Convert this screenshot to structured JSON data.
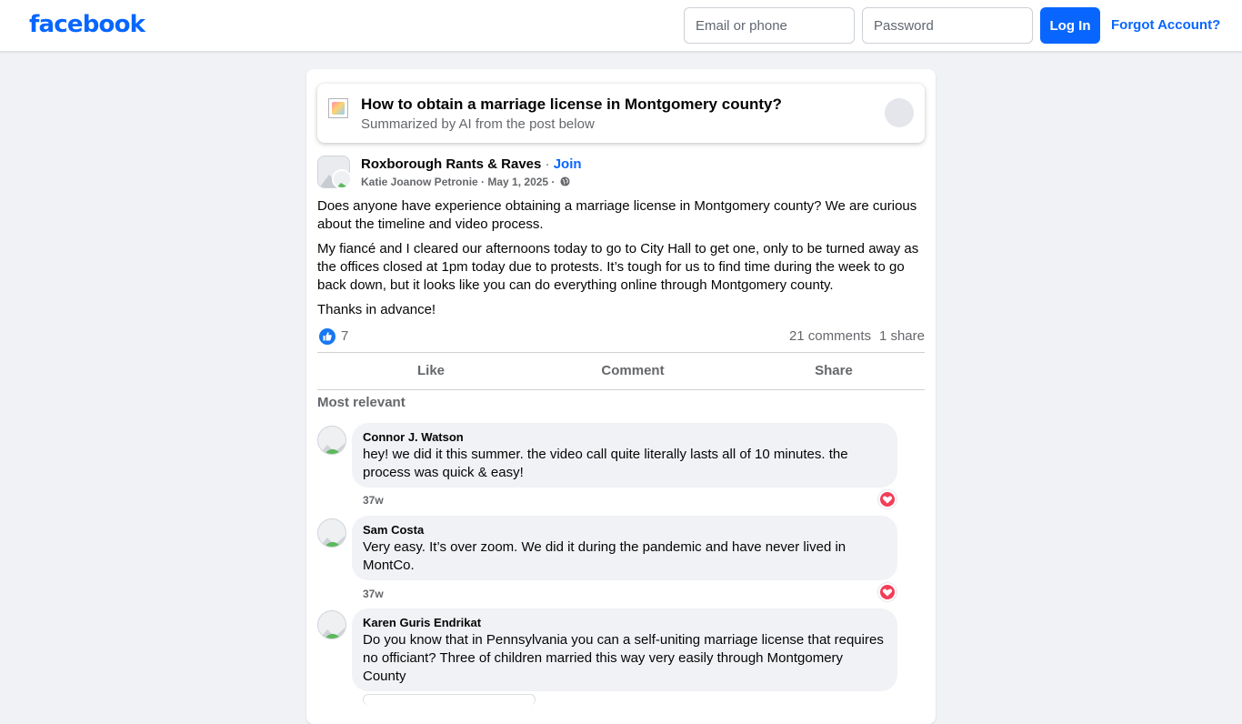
{
  "header": {
    "logo": "facebook",
    "email_placeholder": "Email or phone",
    "password_placeholder": "Password",
    "login_label": "Log In",
    "forgot_label": "Forgot Account?"
  },
  "ai_summary": {
    "title": "How to obtain a marriage license in Montgomery county?",
    "subtitle": "Summarized by AI from the post below"
  },
  "post": {
    "group_name": "Roxborough Rants & Raves",
    "separator": " · ",
    "join_label": "Join",
    "author": "Katie Joanow Petronie",
    "date": "May 1, 2025",
    "paragraphs": [
      "Does anyone have experience obtaining a marriage license in Montgomery county? We are curious about the timeline and video process.",
      "My fiancé and I cleared our afternoons today to go to City Hall to get one, only to be turned away as the offices closed at 1pm today due to protests. It’s tough for us to find time during the week to go back down, but it looks like you can do everything online through Montgomery county.",
      "Thanks in advance!"
    ],
    "reaction_count": "7",
    "comments_count": "21 comments",
    "shares_count": "1 share"
  },
  "actions": {
    "like": "Like",
    "comment": "Comment",
    "share": "Share"
  },
  "sort_label": "Most relevant",
  "comments": [
    {
      "author": "Connor J. Watson",
      "text": "hey! we did it this summer. the video call quite literally lasts all of 10 minutes. the process was quick & easy!",
      "time": "37w"
    },
    {
      "author": "Sam Costa",
      "text": "Very easy. It’s over zoom. We did it during the pandemic and have never lived in MontCo.",
      "time": "37w"
    },
    {
      "author": "Karen Guris Endrikat",
      "text": "Do you know that in Pennsylvania you can a self-uniting marriage license that requires no officiant? Three of children married this way very easily through Montgomery County",
      "time": ""
    }
  ],
  "colors": {
    "brand": "#0866ff",
    "background": "#f0f2f5",
    "heart": "#f33e58",
    "like": "#1877f2"
  }
}
